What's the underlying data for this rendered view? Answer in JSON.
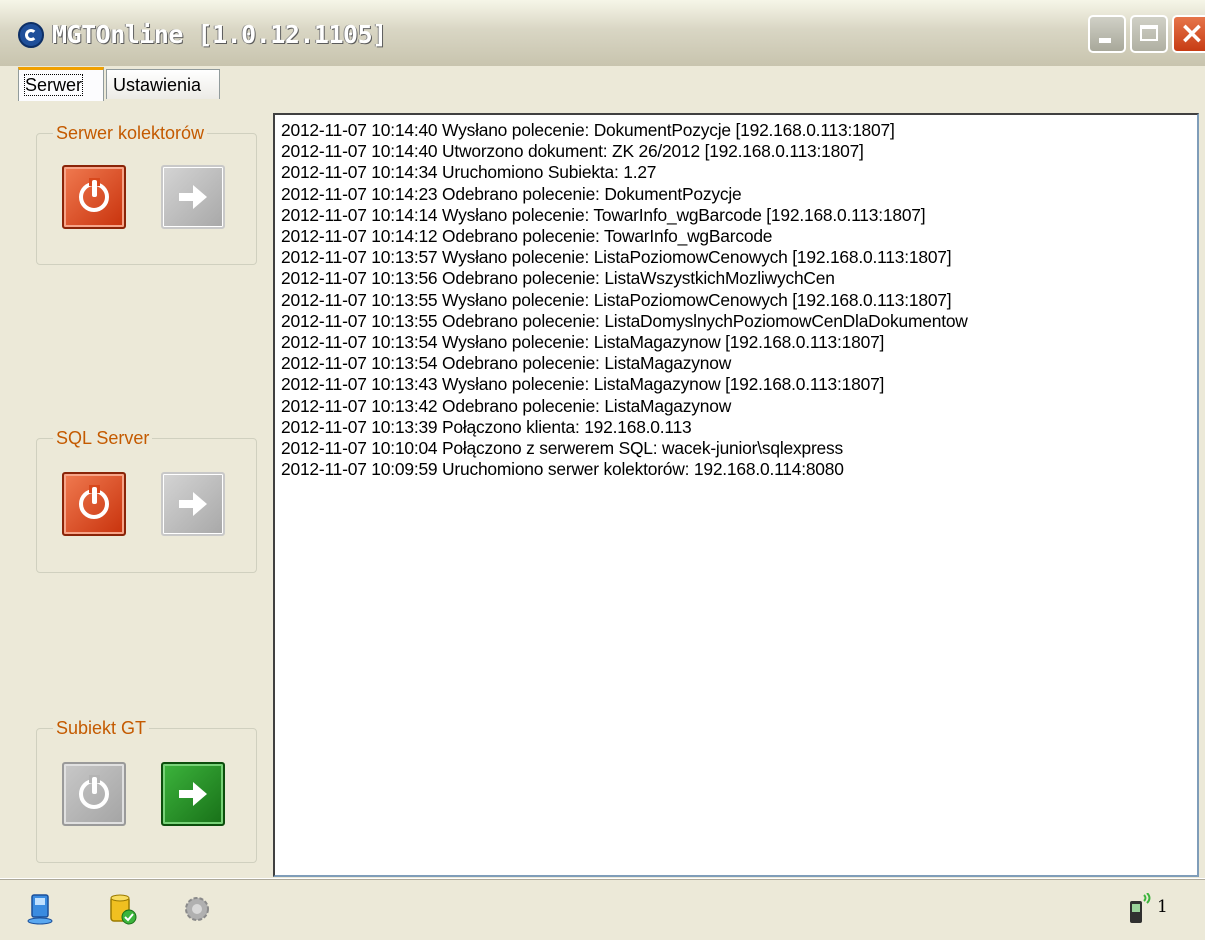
{
  "window": {
    "title": "MGTOnline [1.0.12.1105]",
    "controls": {
      "minimize": "minimize-icon",
      "maximize": "maximize-icon",
      "close": "×"
    }
  },
  "tabs": [
    {
      "label": "Serwer",
      "active": true
    },
    {
      "label": "Ustawienia",
      "active": false
    }
  ],
  "groups": [
    {
      "label": "Serwer kolektorów",
      "power_state": "active",
      "start_state": "disabled"
    },
    {
      "label": "SQL Server",
      "power_state": "active",
      "start_state": "disabled"
    },
    {
      "label": "Subiekt GT",
      "power_state": "disabled",
      "start_state": "active"
    }
  ],
  "log": [
    "2012-11-07 10:14:40  Wysłano polecenie: DokumentPozycje [192.168.0.113:1807]",
    "2012-11-07 10:14:40  Utworzono dokument: ZK 26/2012 [192.168.0.113:1807]",
    "2012-11-07 10:14:34  Uruchomiono Subiekta: 1.27",
    "2012-11-07 10:14:23  Odebrano polecenie: DokumentPozycje",
    "2012-11-07 10:14:14  Wysłano polecenie: TowarInfo_wgBarcode [192.168.0.113:1807]",
    "2012-11-07 10:14:12  Odebrano polecenie: TowarInfo_wgBarcode",
    "2012-11-07 10:13:57  Wysłano polecenie: ListaPoziomowCenowych [192.168.0.113:1807]",
    "2012-11-07 10:13:56  Odebrano polecenie: ListaWszystkichMozliwychCen",
    "2012-11-07 10:13:55  Wysłano polecenie: ListaPoziomowCenowych [192.168.0.113:1807]",
    "2012-11-07 10:13:55  Odebrano polecenie: ListaDomyslnychPoziomowCenDlaDokumentow",
    "2012-11-07 10:13:54  Wysłano polecenie: ListaMagazynow [192.168.0.113:1807]",
    "2012-11-07 10:13:54  Odebrano polecenie: ListaMagazynow",
    "2012-11-07 10:13:43  Wysłano polecenie: ListaMagazynow [192.168.0.113:1807]",
    "2012-11-07 10:13:42  Odebrano polecenie: ListaMagazynow",
    "2012-11-07 10:13:39  Połączono klienta: 192.168.0.113",
    "2012-11-07 10:10:04  Połączono z serwerem SQL: wacek-junior\\sqlexpress",
    "2012-11-07 10:09:59  Uruchomiono serwer kolektorów: 192.168.0.114:8080"
  ],
  "statusbar": {
    "icons": [
      "network-computer-icon",
      "database-ok-icon",
      "subiekt-gear-icon",
      "mobile-signal-icon"
    ],
    "connected_clients": "1"
  }
}
